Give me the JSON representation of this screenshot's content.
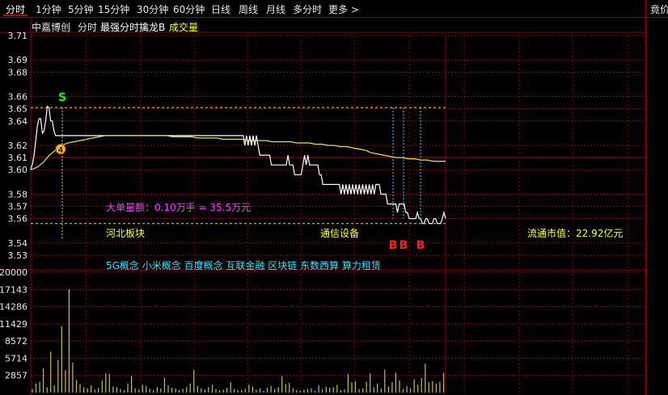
{
  "toolbar": {
    "tabs": [
      "分时",
      "1分钟",
      "5分钟",
      "15分钟",
      "30分钟",
      "60分钟",
      "日线",
      "周线",
      "月线",
      "多分时",
      "更多 >"
    ],
    "active": "分时",
    "right_tab": "竟价"
  },
  "header": {
    "stock_name": "中嘉博创",
    "chart_type": "分时",
    "indicator": "最强分时擒龙B",
    "volume_label": "成交量"
  },
  "price_axis": [
    "3.71",
    "3.69",
    "3.68",
    "3.66",
    "3.65",
    "3.64",
    "3.62",
    "3.61",
    "3.60",
    "3.58",
    "3.57",
    "3.56",
    "3.54",
    "3.53"
  ],
  "volume_axis": [
    "20000",
    "17143",
    "14286",
    "11429",
    "8572",
    "5714",
    "2857"
  ],
  "annotations": {
    "big_order": "大单量额：0.10万手 = 35.5万元",
    "sector": "河北板块",
    "industry": "通信设备",
    "market_cap": "流通市值：22.92亿元",
    "concepts": "5G概念 小米概念 百度概念 互联金融 区块链 东数西算 算力租赁",
    "sell_marker": "S",
    "buy_markers": [
      "B",
      "B",
      "B"
    ],
    "dot_marker": "4"
  },
  "colors": {
    "background": "#000000",
    "grid": "#8b0000",
    "price_line": "#ffffff",
    "avg_line": "#e6e05a",
    "volume_bars": "#c8c040",
    "magenta_text": "#ff40ff",
    "yellow_text": "#ffff40",
    "cyan_text": "#40e0ff",
    "sell_color": "#00ff00",
    "buy_color": "#ff2020"
  },
  "chart_data": {
    "type": "line",
    "xlabel": "",
    "ylabel": "",
    "price": {
      "ylim": [
        3.53,
        3.71
      ],
      "series": [
        {
          "values": [
            3.6,
            3.605,
            3.612,
            3.624,
            3.636,
            3.642,
            3.642,
            3.63,
            3.632,
            3.64,
            3.652,
            3.651,
            3.64,
            3.64,
            3.632,
            3.628,
            3.628,
            3.628,
            3.628,
            3.628,
            3.628,
            3.628,
            3.628,
            3.628,
            3.628,
            3.628,
            3.628,
            3.628,
            3.628,
            3.628,
            3.628,
            3.628,
            3.628,
            3.628,
            3.628,
            3.628,
            3.628,
            3.628,
            3.628,
            3.628,
            3.628,
            3.628,
            3.628,
            3.628,
            3.628,
            3.628,
            3.628,
            3.628,
            3.628,
            3.628,
            3.628,
            3.628,
            3.628,
            3.628,
            3.628,
            3.628,
            3.628,
            3.628,
            3.628,
            3.628,
            3.628,
            3.628,
            3.628,
            3.628,
            3.628,
            3.628,
            3.628,
            3.628,
            3.628,
            3.628,
            3.628,
            3.628,
            3.628,
            3.628,
            3.628,
            3.628,
            3.628,
            3.628,
            3.628,
            3.628,
            3.628,
            3.628,
            3.628,
            3.628,
            3.628,
            3.628,
            3.628,
            3.628,
            3.628,
            3.628,
            3.628,
            3.628,
            3.628,
            3.628,
            3.628,
            3.628,
            3.628,
            3.628,
            3.628,
            3.628,
            3.628,
            3.628,
            3.628,
            3.628,
            3.628,
            3.628,
            3.628,
            3.628,
            3.628,
            3.628,
            3.628,
            3.628,
            3.628,
            3.628,
            3.628,
            3.628,
            3.628,
            3.628,
            3.628,
            3.628,
            3.628,
            3.628,
            3.628,
            3.628,
            3.628,
            3.628,
            3.628,
            3.628,
            3.628,
            3.62,
            3.628,
            3.62,
            3.628,
            3.62,
            3.628,
            3.62,
            3.628,
            3.62,
            3.612,
            3.612,
            3.612,
            3.612,
            3.612,
            3.612,
            3.612,
            3.604,
            3.604,
            3.604,
            3.604,
            3.604,
            3.604,
            3.604,
            3.604,
            3.604,
            3.604,
            3.612,
            3.604,
            3.604,
            3.604,
            3.596,
            3.596,
            3.596,
            3.596,
            3.596,
            3.604,
            3.612,
            3.604,
            3.612,
            3.604,
            3.604,
            3.604,
            3.604,
            3.604,
            3.604,
            3.596,
            3.596,
            3.588,
            3.588,
            3.588,
            3.588,
            3.588,
            3.588,
            3.588,
            3.588,
            3.588,
            3.588,
            3.588,
            3.58,
            3.588,
            3.58,
            3.588,
            3.58,
            3.588,
            3.58,
            3.588,
            3.58,
            3.588,
            3.58,
            3.588,
            3.58,
            3.588,
            3.58,
            3.588,
            3.58,
            3.588,
            3.58,
            3.588,
            3.58,
            3.588,
            3.588,
            3.588,
            3.58,
            3.58,
            3.58,
            3.58,
            3.572,
            3.572,
            3.572,
            3.572,
            3.572,
            3.572,
            3.565,
            3.572,
            3.572,
            3.572,
            3.572,
            3.565,
            3.565,
            3.56,
            3.56,
            3.56,
            3.56,
            3.56,
            3.565,
            3.56,
            3.56,
            3.556,
            3.556,
            3.56,
            3.56,
            3.556,
            3.556,
            3.556,
            3.56,
            3.56,
            3.556,
            3.556,
            3.556,
            3.56,
            3.565,
            3.56
          ]
        },
        {
          "values": [
            3.6,
            3.602,
            3.606,
            3.612,
            3.616,
            3.62,
            3.622,
            3.623,
            3.624,
            3.625,
            3.626,
            3.627,
            3.628,
            3.628,
            3.628,
            3.628,
            3.628,
            3.628,
            3.628,
            3.628,
            3.628,
            3.628,
            3.628,
            3.627,
            3.627,
            3.627,
            3.627,
            3.626,
            3.626,
            3.626,
            3.626,
            3.625,
            3.625,
            3.625,
            3.625,
            3.624,
            3.624,
            3.624,
            3.624,
            3.623,
            3.623,
            3.623,
            3.623,
            3.622,
            3.622,
            3.622,
            3.621,
            3.621,
            3.62,
            3.62,
            3.619,
            3.619,
            3.618,
            3.617,
            3.616,
            3.614,
            3.613,
            3.612,
            3.611,
            3.61,
            3.61,
            3.609,
            3.609,
            3.608,
            3.608,
            3.607,
            3.607,
            3.607
          ]
        }
      ]
    },
    "volume": {
      "ylim": [
        0,
        20000
      ],
      "values": [
        600,
        1500,
        1800,
        4000,
        900,
        6800,
        1200,
        5400,
        11000,
        3700,
        17200,
        5000,
        2100,
        1400,
        900,
        700,
        1200,
        500,
        800,
        2000,
        3200,
        3100,
        1000,
        900,
        600,
        400,
        1500,
        2800,
        700,
        500,
        1300,
        1100,
        600,
        400,
        900,
        700,
        2500,
        1200,
        800,
        700,
        400,
        600,
        900,
        1500,
        3800,
        1100,
        700,
        500,
        900,
        1300,
        600,
        400,
        500,
        800,
        1700,
        600,
        400,
        400,
        600,
        1300,
        1000,
        500,
        700,
        300,
        800,
        1100,
        600,
        900,
        2700,
        1400,
        1600,
        700,
        400,
        300,
        500,
        600,
        700,
        300,
        1200,
        500,
        1000,
        800,
        900,
        1300,
        400,
        500,
        3100,
        1700,
        1900,
        600,
        700,
        1800,
        3200,
        900,
        1500,
        700,
        3800,
        1000,
        1700,
        3300,
        2000,
        600,
        1100,
        700,
        2200,
        1300,
        2400,
        4800,
        1700,
        1900,
        1500,
        1800,
        3300
      ]
    }
  }
}
